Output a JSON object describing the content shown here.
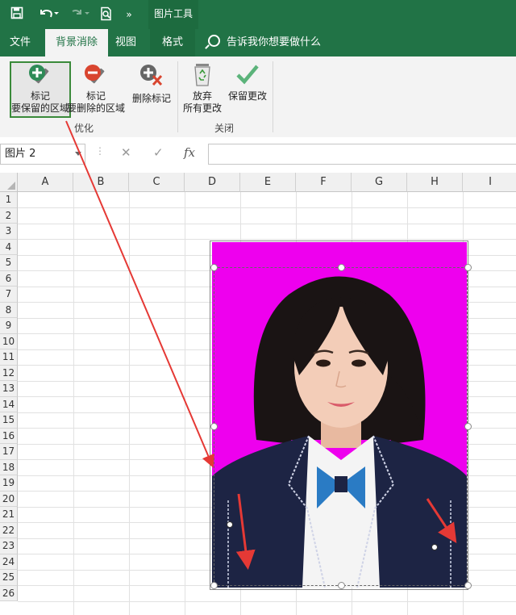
{
  "quick_access": {
    "save_icon": "save-icon",
    "undo_icon": "undo-icon",
    "redo_icon": "redo-icon",
    "print_preview_icon": "print-preview-icon",
    "more_icon": "more-commands-icon"
  },
  "context_tab_group": "图片工具",
  "tabs": {
    "file": "文件",
    "background_removal": "背景消除",
    "view": "视图",
    "format": "格式"
  },
  "tell_me": "告诉我你想要做什么",
  "ribbon": {
    "mark_keep_line1": "标记",
    "mark_keep_line2": "要保留的区域",
    "mark_remove_line1": "标记",
    "mark_remove_line2": "要删除的区域",
    "delete_mark": "删除标记",
    "discard_line1": "放弃",
    "discard_line2": "所有更改",
    "keep_changes": "保留更改",
    "group_refine": "优化",
    "group_close": "关闭"
  },
  "formula_bar": {
    "name_box": "图片 2",
    "cancel": "✕",
    "enter": "✓",
    "fx": "fx",
    "formula": ""
  },
  "sheet": {
    "columns": [
      "A",
      "B",
      "C",
      "D",
      "E",
      "F",
      "G",
      "H",
      "I"
    ],
    "rows": [
      "1",
      "2",
      "3",
      "4",
      "5",
      "6",
      "7",
      "8",
      "9",
      "10",
      "11",
      "12",
      "13",
      "14",
      "15",
      "16",
      "17",
      "18",
      "19",
      "20",
      "21",
      "22",
      "23",
      "24",
      "25",
      "26"
    ]
  },
  "colors": {
    "excel_green": "#217346",
    "remove_background": "#ee00ee",
    "arrow": "#e53935"
  }
}
